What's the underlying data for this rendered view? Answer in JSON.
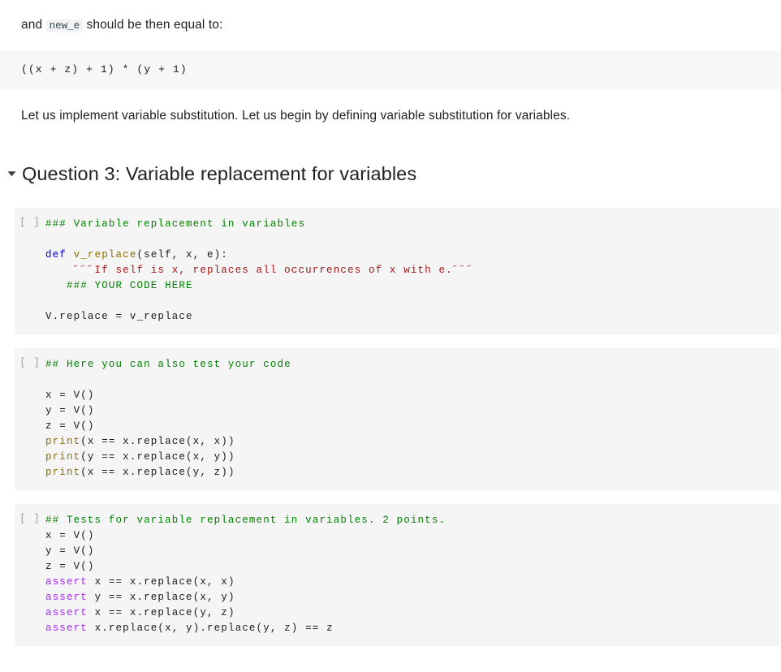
{
  "prose": {
    "intro_before": "and ",
    "intro_code": "new_e",
    "intro_after": " should be then equal to:",
    "expression_block": "((x + z) + 1) * (y + 1)",
    "paragraph": "Let us implement variable substitution. Let us begin by defining variable substitution for variables."
  },
  "section": {
    "disclosure_state": "expanded",
    "title": "Question 3: Variable replacement for variables"
  },
  "cells": [
    {
      "run_indicator": "[ ]",
      "lines": [
        [
          {
            "t": "### Variable replacement in variables",
            "c": "tok-com"
          }
        ],
        [
          {
            "t": "",
            "c": "tok-pl"
          }
        ],
        [
          {
            "t": "def ",
            "c": "tok-kw"
          },
          {
            "t": "v_replace",
            "c": "tok-fn"
          },
          {
            "t": "(self, x, e):",
            "c": "tok-pl"
          }
        ],
        [
          {
            "t": "    ˝˝˝If self is x, replaces all occurrences of x with e.˝˝˝",
            "c": "tok-str"
          }
        ],
        [
          {
            "t": "   ",
            "c": "tok-pl"
          },
          {
            "t": "### YOUR CODE HERE",
            "c": "tok-com"
          }
        ],
        [
          {
            "t": "",
            "c": "tok-pl"
          }
        ],
        [
          {
            "t": "V.replace = v_replace",
            "c": "tok-pl"
          }
        ]
      ]
    },
    {
      "run_indicator": "[ ]",
      "lines": [
        [
          {
            "t": "## Here you can also test your code",
            "c": "tok-com"
          }
        ],
        [
          {
            "t": "",
            "c": "tok-pl"
          }
        ],
        [
          {
            "t": "x = V()",
            "c": "tok-pl"
          }
        ],
        [
          {
            "t": "y = V()",
            "c": "tok-pl"
          }
        ],
        [
          {
            "t": "z = V()",
            "c": "tok-pl"
          }
        ],
        [
          {
            "t": "print",
            "c": "tok-bi"
          },
          {
            "t": "(x == x.replace(x, x))",
            "c": "tok-pl"
          }
        ],
        [
          {
            "t": "print",
            "c": "tok-bi"
          },
          {
            "t": "(y == x.replace(x, y))",
            "c": "tok-pl"
          }
        ],
        [
          {
            "t": "print",
            "c": "tok-bi"
          },
          {
            "t": "(x == x.replace(y, z))",
            "c": "tok-pl"
          }
        ]
      ]
    },
    {
      "run_indicator": "[ ]",
      "lines": [
        [
          {
            "t": "## Tests for variable replacement in variables. 2 points.",
            "c": "tok-com"
          }
        ],
        [
          {
            "t": "x = V()",
            "c": "tok-pl"
          }
        ],
        [
          {
            "t": "y = V()",
            "c": "tok-pl"
          }
        ],
        [
          {
            "t": "z = V()",
            "c": "tok-pl"
          }
        ],
        [
          {
            "t": "assert",
            "c": "tok-kw2"
          },
          {
            "t": " x == x.replace(x, x)",
            "c": "tok-pl"
          }
        ],
        [
          {
            "t": "assert",
            "c": "tok-kw2"
          },
          {
            "t": " y == x.replace(x, y)",
            "c": "tok-pl"
          }
        ],
        [
          {
            "t": "assert",
            "c": "tok-kw2"
          },
          {
            "t": " x == x.replace(y, z)",
            "c": "tok-pl"
          }
        ],
        [
          {
            "t": "assert",
            "c": "tok-kw2"
          },
          {
            "t": " x.replace(x, y).replace(y, z) == z",
            "c": "tok-pl"
          }
        ]
      ]
    }
  ],
  "colors": {
    "cell_background": "#f5f5f5",
    "codeblock_background": "#f7f7f7",
    "comment": "#008000",
    "keyword": "#0000cd",
    "keyword_alt": "#aa22ff",
    "builtin": "#8a6d00",
    "string": "#a31515",
    "gutter": "#9aa0a6",
    "text": "#212121"
  }
}
